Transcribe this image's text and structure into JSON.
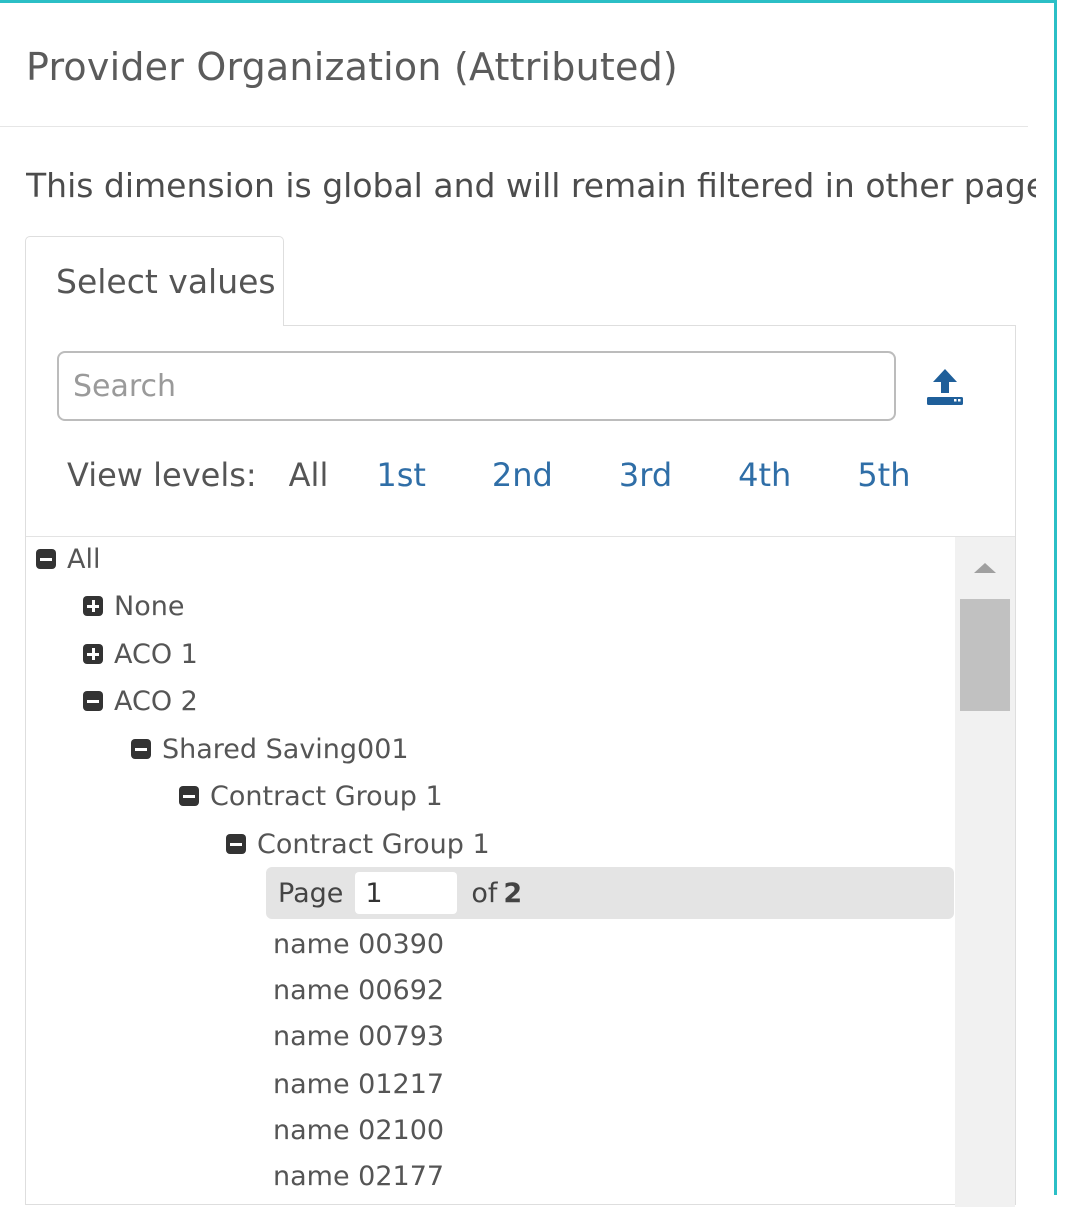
{
  "dialog": {
    "title": "Provider Organization (Attributed)",
    "description": "This dimension is global and will remain filtered in other pages y"
  },
  "tabs": [
    {
      "label": "Select values"
    }
  ],
  "search": {
    "placeholder": "Search",
    "value": ""
  },
  "upload_icon": "upload-icon",
  "view_levels": {
    "label": "View levels:",
    "levels": [
      "All",
      "1st",
      "2nd",
      "3rd",
      "4th",
      "5th"
    ]
  },
  "tree": {
    "nodes": [
      {
        "label": "All",
        "state": "expanded"
      },
      {
        "label": "None",
        "state": "collapsed"
      },
      {
        "label": "ACO 1",
        "state": "collapsed"
      },
      {
        "label": "ACO 2",
        "state": "expanded"
      },
      {
        "label": "Shared Saving001",
        "state": "expanded"
      },
      {
        "label": "Contract Group 1",
        "state": "expanded"
      },
      {
        "label": "Contract Group 1",
        "state": "expanded"
      }
    ],
    "pager": {
      "page_label": "Page",
      "current_page": "1",
      "of_label": "of",
      "total_pages": "2"
    },
    "leaves": [
      "name 00390",
      "name 00692",
      "name 00793",
      "name 01217",
      "name 02100",
      "name 02177"
    ]
  },
  "colors": {
    "accent_border": "#2bbfc6",
    "link": "#2f6ea7",
    "toggle": "#333333"
  }
}
